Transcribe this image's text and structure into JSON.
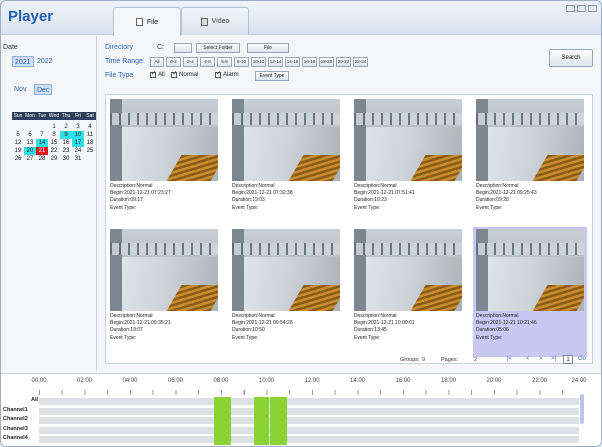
{
  "app": {
    "title": "Player"
  },
  "tabs": [
    {
      "label": "File",
      "icon": "file-icon",
      "active": true
    },
    {
      "label": "Video",
      "icon": "video-icon",
      "active": false
    }
  ],
  "left": {
    "date_label": "Date",
    "years": [
      {
        "label": "2021",
        "selected": true
      },
      {
        "label": "2022",
        "selected": false
      }
    ],
    "months": [
      {
        "label": "Nov.",
        "selected": false
      },
      {
        "label": "Dec",
        "selected": true
      }
    ],
    "calendar": {
      "weekdays": [
        "Sun",
        "Mon",
        "Tue",
        "Wed",
        "Thu",
        "Fri",
        "Sat"
      ],
      "days": [
        "",
        "",
        "",
        "1",
        "2",
        "3",
        "4",
        "5",
        "6",
        "7",
        "8",
        "9",
        "10",
        "11",
        "12",
        "13",
        "14",
        "15",
        "16",
        "17",
        "18",
        "19",
        "20",
        "21",
        "22",
        "23",
        "24",
        "25",
        "26",
        "27",
        "28",
        "29",
        "30",
        "31",
        ""
      ],
      "recorded_days": [
        "9",
        "10",
        "14",
        "17",
        "20"
      ],
      "selected_day": "21"
    }
  },
  "filters": {
    "directory_label": "Directory",
    "directory_value": "C:",
    "select_folder_label": "Select Folder",
    "file_button_label": "File",
    "time_range_label": "Time Range",
    "time_ranges": [
      "All",
      "0-2",
      "2-4",
      "4-6",
      "6-8",
      "8-10",
      "10-12",
      "12-14",
      "14-16",
      "16-18",
      "18-20",
      "20-22",
      "22-24"
    ],
    "file_type_label": "File Type",
    "checkboxes": [
      {
        "label": "All",
        "checked": true
      },
      {
        "label": "Normal",
        "checked": true
      },
      {
        "label": "Alarm",
        "checked": true
      }
    ],
    "event_type_label": "Event Type",
    "search_label": "Search"
  },
  "results": [
    {
      "description": "Description:Normal",
      "begin": "Begin:2021-12-21 07:23:27",
      "duration": "Duration:09:17",
      "event": "Event Type:",
      "selected": false
    },
    {
      "description": "Description:Normal",
      "begin": "Begin:2021-12-21 07:32:38",
      "duration": "Duration:19:03",
      "event": "Event Type:",
      "selected": false
    },
    {
      "description": "Description:Normal",
      "begin": "Begin:2021-12-21 07:51:41",
      "duration": "Duration:10:23",
      "event": "Event Type:",
      "selected": false
    },
    {
      "description": "Description:Normal",
      "begin": "Begin:2021-12-21 09:25:43",
      "duration": "Duration:09:28",
      "event": "Event Type:",
      "selected": false
    },
    {
      "description": "Description:Normal",
      "begin": "Begin:2021-12-21 09:35:21",
      "duration": "Duration:19:07",
      "event": "Event Type:",
      "selected": false
    },
    {
      "description": "Description:Normal",
      "begin": "Begin:2021-12-21 09:54:28",
      "duration": "Duration:10:50",
      "event": "Event Type:",
      "selected": false
    },
    {
      "description": "Description:Normal",
      "begin": "Begin:2021-12-21 10:00:01",
      "duration": "Duration:13:45",
      "event": "Event Type:",
      "selected": false
    },
    {
      "description": "Description:Normal",
      "begin": "Begin:2021-12-21 10:21:46",
      "duration": "Duration:05:06",
      "event": "Event Type:",
      "selected": true
    }
  ],
  "pager": {
    "groups_label": "Groups:",
    "groups_value": "9",
    "pages_label": "Pages:",
    "pages_value": "2",
    "first": "|<",
    "prev": "<",
    "next": ">",
    "last": ">|",
    "page_input": "1",
    "go_label": "Go"
  },
  "timeline": {
    "ticks": [
      "00:00",
      "02:00",
      "04:00",
      "06:00",
      "08:00",
      "10:00",
      "12:00",
      "14:00",
      "16:00",
      "18:00",
      "20:00",
      "22:00",
      "24:00"
    ],
    "channels": [
      "All",
      "Channel1",
      "Channel2",
      "Channel3",
      "Channel4"
    ],
    "recordings_hours": [
      [
        7.7,
        8.45
      ],
      [
        9.45,
        10.1
      ],
      [
        10.15,
        10.9
      ]
    ],
    "segment_color": "#8bd237"
  },
  "colors": {
    "accent": "#1f5fae",
    "recorded_day": "#2ee0e7",
    "today": "#e0191f",
    "selection": "#c9c8f3"
  }
}
